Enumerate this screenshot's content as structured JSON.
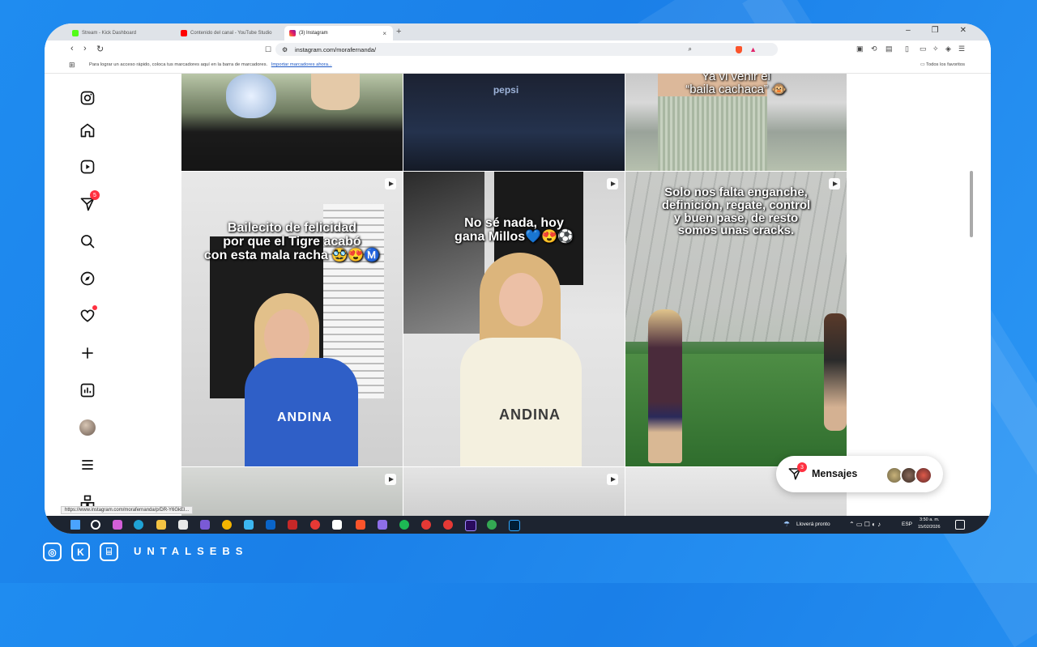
{
  "browser": {
    "tabs": [
      {
        "label": "Stream - Kick Dashboard",
        "active": false
      },
      {
        "label": "Contenido del canal - YouTube Studio",
        "active": false
      },
      {
        "label": "(3) Instagram",
        "active": true
      }
    ],
    "url": "instagram.com/morafernanda/",
    "bookmarks_message": "Para lograr un acceso rápido, coloca tus marcadores aquí en la barra de marcadores.",
    "bookmarks_link": "Importar marcadores ahora...",
    "favorites_label": "Todos los favoritos",
    "status_url": "https://www.instagram.com/morafernanda/p/DR-Y6GkEl..."
  },
  "sidebar": {
    "notifications_badge": "5"
  },
  "posts": [
    {
      "caption": ""
    },
    {
      "caption": "pepsi"
    },
    {
      "caption": "Ya vi venir el\n“baila cachaca” 🐵"
    },
    {
      "caption": "Bailecito de felicidad\npor que el Tigre acabó\ncon esta mala racha 🥸😍Ⓜ️"
    },
    {
      "caption": "No sé nada, hoy\ngana Millos💙😍⚽"
    },
    {
      "caption": "Solo nos falta enganche,\ndefinición, regate, control\ny buen pase, de resto\nsomos unas cracks."
    }
  ],
  "jersey_text": "ANDINA",
  "messages": {
    "label": "Mensajes",
    "badge": "3"
  },
  "taskbar": {
    "weather": "Lloverá pronto",
    "lang": "ESP",
    "time": "3:50 a. m.",
    "date": "15/02/2026"
  },
  "branding": {
    "name": "UNTALSEBS"
  },
  "colors": {
    "background": "#1f8cf0",
    "notification_red": "#ff3040",
    "taskbar": "#1d2430"
  }
}
